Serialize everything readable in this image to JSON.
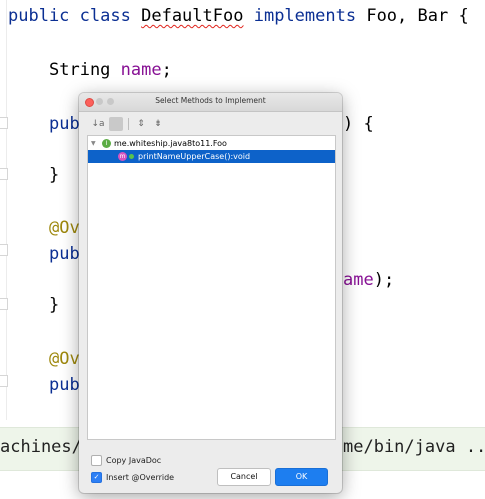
{
  "editor": {
    "line1": {
      "kw1": "public",
      "kw2": "class",
      "classname": "DefaultFoo",
      "kw3": "implements",
      "rest": "Foo, Bar {"
    },
    "line2": {
      "type": "String",
      "field": "name",
      "semi": ";"
    },
    "line3_left": "pub",
    "line3_right": ") {",
    "line4": "}",
    "line5": "@Ov",
    "line6_left": "pub",
    "line6_right_field": "ame",
    "line6_right_rest": ");",
    "line7": "}",
    "line8": "@Ov",
    "line9": "pub"
  },
  "run_bar": {
    "left_text": "achines/",
    "right_text": "me/bin/java .."
  },
  "dialog": {
    "title": "Select Methods to Implement",
    "toolbar": {
      "sort_label": "↓a",
      "group_label": "",
      "expand_label": "⇕",
      "collapse_label": "⇟"
    },
    "tree": {
      "class_badge": "I",
      "class_label": "me.whiteship.java8to11.Foo",
      "method_badge": "m",
      "method_label": "printNameUpperCase():void"
    },
    "options": {
      "copy_javadoc": {
        "label": "Copy JavaDoc",
        "checked": false
      },
      "insert_override": {
        "label": "Insert @Override",
        "checked": true
      }
    },
    "buttons": {
      "cancel": "Cancel",
      "ok": "OK"
    }
  }
}
